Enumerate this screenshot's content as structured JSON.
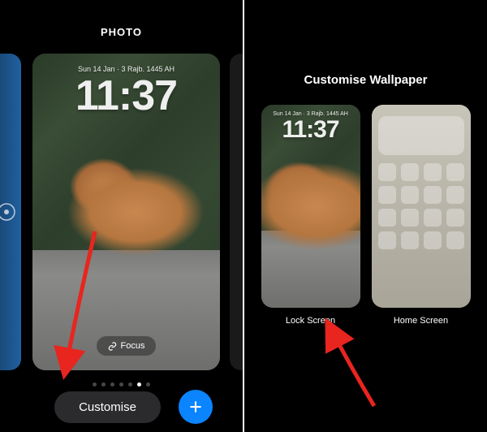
{
  "left": {
    "header": "PHOTO",
    "lock": {
      "date": "Sun 14 Jan · 3 Rajb. 1445 AH",
      "time": "11:37"
    },
    "focus_label": "Focus",
    "customise_label": "Customise",
    "page_count": 7,
    "active_page_index": 5
  },
  "right": {
    "title": "Customise Wallpaper",
    "lock": {
      "date": "Sun 14 Jan · 3 Rajb. 1445 AH",
      "time": "11:37"
    },
    "lock_label": "Lock Screen",
    "home_label": "Home Screen"
  }
}
